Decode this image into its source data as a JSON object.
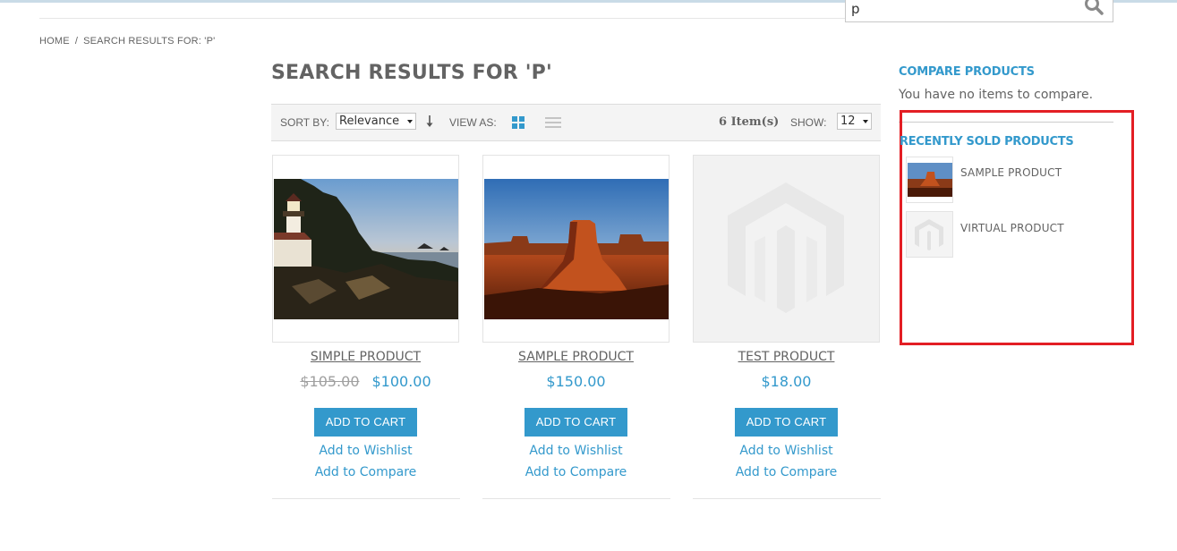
{
  "search": {
    "value": "p"
  },
  "breadcrumb": {
    "home": "HOME",
    "separator": "/",
    "current": "SEARCH RESULTS FOR: 'P'"
  },
  "page_title": "SEARCH RESULTS FOR 'P'",
  "toolbar": {
    "sort_label": "SORT BY:",
    "sort_value": "Relevance",
    "view_label": "VIEW AS:",
    "item_count": "6 Item(s)",
    "show_label": "SHOW:",
    "show_value": "12"
  },
  "products": [
    {
      "name": "SIMPLE PRODUCT",
      "old_price": "$105.00",
      "price": "$100.00",
      "cart_label": "ADD TO CART",
      "wishlist_label": "Add to Wishlist",
      "compare_label": "Add to Compare",
      "image": "lighthouse-photo"
    },
    {
      "name": "SAMPLE PRODUCT",
      "price": "$150.00",
      "cart_label": "ADD TO CART",
      "wishlist_label": "Add to Wishlist",
      "compare_label": "Add to Compare",
      "image": "desert-butte-photo"
    },
    {
      "name": "TEST PRODUCT",
      "price": "$18.00",
      "cart_label": "ADD TO CART",
      "wishlist_label": "Add to Wishlist",
      "compare_label": "Add to Compare",
      "image": "magento-placeholder-logo"
    }
  ],
  "compare": {
    "title": "COMPARE PRODUCTS",
    "empty_text": "You have no items to compare."
  },
  "recently_sold": {
    "title": "RECENTLY SOLD PRODUCTS",
    "items": [
      {
        "name": "SAMPLE PRODUCT",
        "image": "desert-butte-photo"
      },
      {
        "name": "VIRTUAL PRODUCT",
        "image": "magento-placeholder-logo"
      }
    ]
  },
  "colors": {
    "accent": "#3399cc",
    "text": "#636363",
    "highlight": "#e31e24",
    "toolbar_bg": "#f4f4f4"
  },
  "icons": [
    "search-icon",
    "sort-direction-icon",
    "grid-view-icon",
    "list-view-icon",
    "chevron-down-icon"
  ]
}
